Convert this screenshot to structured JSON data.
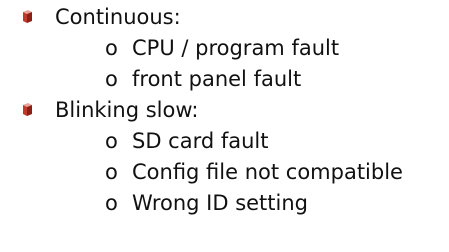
{
  "document": {
    "bullet_icon": "red-cube-icon",
    "accent_color": "#c0392b",
    "sub_marker": "o",
    "items": [
      {
        "label": "Continuous:",
        "sub_items": [
          "CPU / program fault",
          "front panel fault"
        ]
      },
      {
        "label": "Blinking slow:",
        "sub_items": [
          "SD card fault",
          "Config file not compatible",
          "Wrong ID setting"
        ]
      }
    ]
  }
}
